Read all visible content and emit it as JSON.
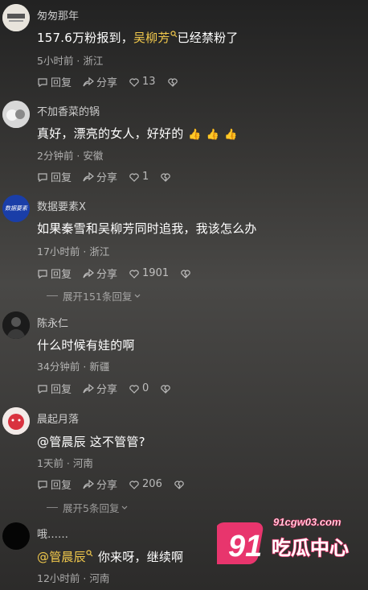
{
  "comments": [
    {
      "username": "匆匆那年",
      "content_parts": [
        "157.6万粉报到，",
        "吴柳芳",
        "已经禁粉了"
      ],
      "meta": "5小时前 · 浙江",
      "reply": "回复",
      "share": "分享",
      "likes": "13"
    },
    {
      "username": "不加香菜的锅",
      "content": "真好，漂亮的女人，好好的",
      "meta": "2分钟前 · 安徽",
      "reply": "回复",
      "share": "分享",
      "likes": "1"
    },
    {
      "username": "数据要素X",
      "avatar_text": "数据要素",
      "content": "如果秦雪和吴柳芳同时追我，我该怎么办",
      "meta": "17小时前 · 浙江",
      "reply": "回复",
      "share": "分享",
      "likes": "1901",
      "expand": "展开151条回复"
    },
    {
      "username": "陈永仁",
      "content": "什么时候有娃的啊",
      "meta": "34分钟前 · 新疆",
      "reply": "回复",
      "share": "分享",
      "likes": "0"
    },
    {
      "username": "晨起月落",
      "content": "@管晨辰  这不管管?",
      "meta": "1天前 · 河南",
      "reply": "回复",
      "share": "分享",
      "likes": "206",
      "expand": "展开5条回复"
    },
    {
      "username": "哦……",
      "content_parts": [
        "@管晨辰",
        "你来呀，继续啊"
      ],
      "meta": "12小时前 · 河南"
    }
  ],
  "watermark": {
    "number": "91",
    "url": "91cgw03.com",
    "name": "吃瓜中心"
  },
  "colors": {
    "mention": "#f2c94c",
    "watermark_pink": "#e8356d"
  }
}
